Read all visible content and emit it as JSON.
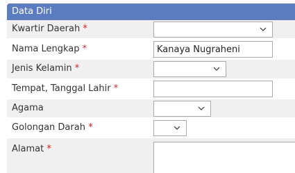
{
  "section_title": "Data Diri",
  "required_marker": "*",
  "fields": {
    "kwartir_daerah": {
      "label": "Kwartir Daerah",
      "value": ""
    },
    "nama_lengkap": {
      "label": "Nama Lengkap",
      "value": "Kanaya Nugraheni"
    },
    "jenis_kelamin": {
      "label": "Jenis Kelamin",
      "value": ""
    },
    "tempat_tanggal_lahir": {
      "label": "Tempat, Tanggal Lahir",
      "value": ""
    },
    "agama": {
      "label": "Agama",
      "value": ""
    },
    "golongan_darah": {
      "label": "Golongan Darah",
      "value": ""
    },
    "alamat": {
      "label": "Alamat",
      "value": ""
    }
  },
  "icons": {
    "dropdown": "chevron-down-icon"
  },
  "colors": {
    "header_bg": "#5b7cc0",
    "header_text": "#ffffff",
    "row_alt_bg": "#f0f0f0",
    "required": "#cc2222"
  }
}
